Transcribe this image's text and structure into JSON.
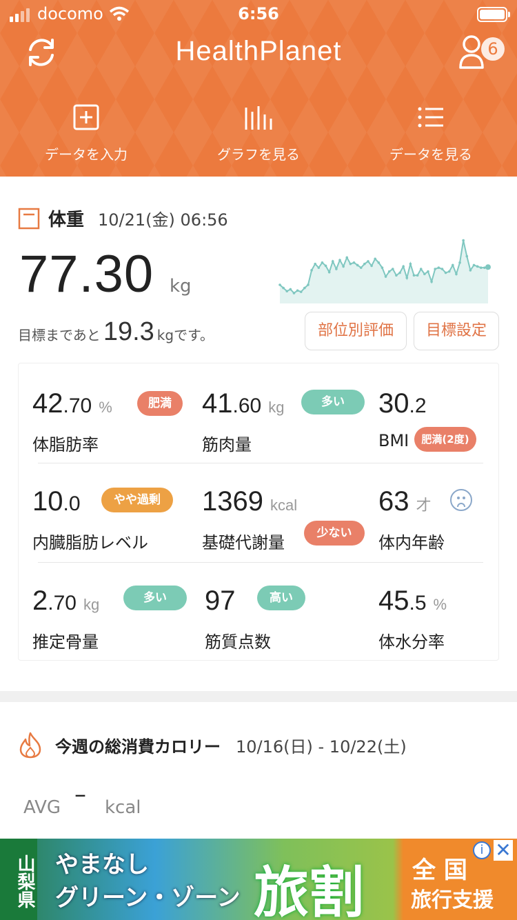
{
  "status_bar": {
    "carrier": "docomo",
    "time": "6:56"
  },
  "header": {
    "app_title": "HealthPlanet",
    "user_badge": "6",
    "nav": [
      {
        "label": "データを入力",
        "icon": "plus-box-icon"
      },
      {
        "label": "グラフを見る",
        "icon": "bar-graph-icon"
      },
      {
        "label": "データを見る",
        "icon": "list-icon"
      }
    ]
  },
  "weight": {
    "label": "体重",
    "datetime": "10/21(金) 06:56",
    "value": "77.30",
    "unit": "kg",
    "goal_prefix": "目標まであと",
    "goal_value": "19.3",
    "goal_unit": "kg",
    "goal_suffix": "です。",
    "btn_parts": "部位別評価",
    "btn_goal": "目標設定",
    "trend": [
      0.25,
      0.2,
      0.15,
      0.18,
      0.12,
      0.16,
      0.14,
      0.2,
      0.25,
      0.48,
      0.58,
      0.52,
      0.6,
      0.55,
      0.45,
      0.62,
      0.5,
      0.64,
      0.54,
      0.68,
      0.58,
      0.6,
      0.56,
      0.52,
      0.58,
      0.62,
      0.55,
      0.66,
      0.6,
      0.52,
      0.38,
      0.46,
      0.5,
      0.4,
      0.44,
      0.54,
      0.36,
      0.58,
      0.4,
      0.4,
      0.5,
      0.42,
      0.46,
      0.3,
      0.5,
      0.52,
      0.5,
      0.44,
      0.46,
      0.56,
      0.42,
      0.6,
      0.95,
      0.7,
      0.48,
      0.56,
      0.54,
      0.52,
      0.52,
      0.53
    ]
  },
  "metrics": [
    {
      "value_int": "42",
      "value_dec": ".70",
      "unit": "%",
      "label": "体脂肪率",
      "badge": "肥満",
      "badge_color": "#e98068"
    },
    {
      "value_int": "41",
      "value_dec": ".60",
      "unit": "kg",
      "label": "筋肉量",
      "badge": "多い",
      "badge_color": "#7ccbb5"
    },
    {
      "value_int": "30",
      "value_dec": ".2",
      "unit": "",
      "label": "BMI",
      "badge": "肥満(2度)",
      "badge_color": "#e98068"
    },
    {
      "value_int": "10",
      "value_dec": ".0",
      "unit": "",
      "label": "内臓脂肪レベル",
      "badge": "やや過剰",
      "badge_color": "#eda144"
    },
    {
      "value_int": "1369",
      "value_dec": "",
      "unit": "kcal",
      "label": "基礎代謝量",
      "badge": "少ない",
      "badge_color": "#e98068"
    },
    {
      "value_int": "63",
      "value_dec": "",
      "unit": "才",
      "label": "体内年齢",
      "badge": "",
      "badge_color": ""
    },
    {
      "value_int": "2",
      "value_dec": ".70",
      "unit": "kg",
      "label": "推定骨量",
      "badge": "多い",
      "badge_color": "#7ccbb5"
    },
    {
      "value_int": "97",
      "value_dec": "",
      "unit": "",
      "label": "筋質点数",
      "badge": "高い",
      "badge_color": "#7ccbb5"
    },
    {
      "value_int": "45",
      "value_dec": ".5",
      "unit": "%",
      "label": "体水分率",
      "badge": "",
      "badge_color": ""
    }
  ],
  "calories": {
    "title": "今週の総消費カロリー",
    "range": "10/16(日) - 10/22(土)",
    "avg_label": "AVG",
    "avg_value": "–",
    "avg_unit": "kcal"
  },
  "ad": {
    "prefecture": "山梨県",
    "line1": "やまなし",
    "line2": "グリーン・ゾーン",
    "big": "旅割",
    "right1": "全 国",
    "right2": "旅行支援",
    "info": "i",
    "close": "✕"
  }
}
